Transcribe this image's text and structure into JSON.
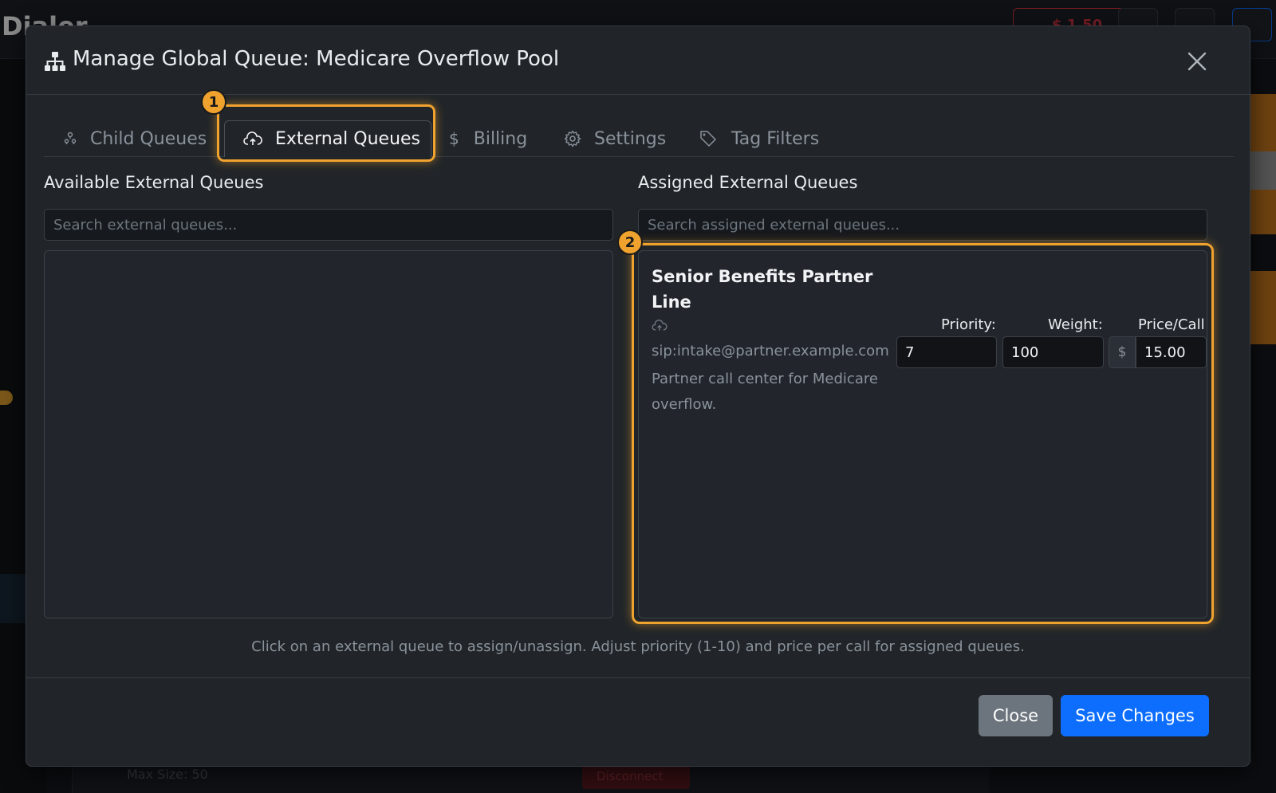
{
  "background": {
    "brand": "Dialer",
    "credit_balance": "$ 1.50",
    "disconnect_label": "Disconnect",
    "max_size": "Max Size: 50"
  },
  "modal": {
    "title": "Manage Global Queue: Medicare Overflow Pool",
    "title_icon": "sitemap-icon",
    "close_icon": "close-icon"
  },
  "tabs": [
    {
      "label": "Child Queues",
      "icon": "people-icon",
      "active": false
    },
    {
      "label": "External Queues",
      "icon": "cloud-upload-icon",
      "active": true
    },
    {
      "label": "Billing",
      "icon": "dollar-icon",
      "active": false
    },
    {
      "label": "Settings",
      "icon": "gear-icon",
      "active": false
    },
    {
      "label": "Tag Filters",
      "icon": "tags-icon",
      "active": false
    }
  ],
  "available": {
    "heading": "Available External Queues",
    "search_placeholder": "Search external queues...",
    "items": []
  },
  "assigned": {
    "heading": "Assigned External Queues",
    "search_placeholder": "Search assigned external queues...",
    "items": [
      {
        "name": "Senior Benefits Partner Line",
        "icon": "cloud-upload-icon",
        "sip": "sip:intake@partner.example.com",
        "description": "Partner call center for Medicare overflow.",
        "priority_label": "Priority:",
        "priority": "7",
        "weight_label": "Weight:",
        "weight": "100",
        "price_label": "Price/Call",
        "currency": "$",
        "price": "15.00"
      }
    ]
  },
  "annotations": [
    "1",
    "2"
  ],
  "help_text": "Click on an external queue to assign/unassign. Adjust priority (1-10) and price per call for assigned queues.",
  "footer": {
    "close_label": "Close",
    "save_label": "Save Changes"
  },
  "colors": {
    "highlight": "#f0a22e",
    "primary": "#0d6efd",
    "secondary": "#6c757d",
    "modal_bg": "#212529"
  }
}
